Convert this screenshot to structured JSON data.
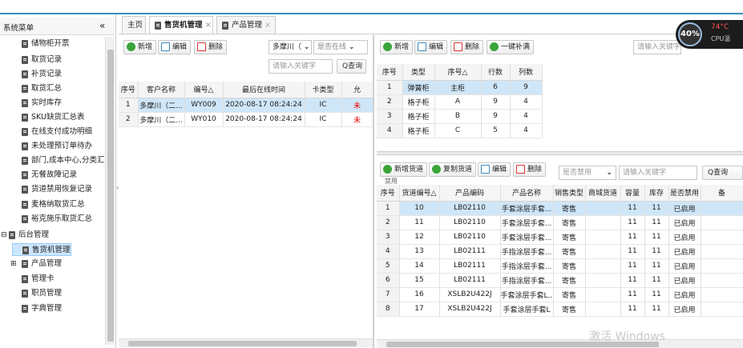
{
  "sidebar": {
    "title": "系统菜单",
    "collapse": "«",
    "items": [
      {
        "label": "储物柜开票",
        "icon": "file-icon"
      },
      {
        "label": "取货记录",
        "icon": "file-icon"
      },
      {
        "label": "补货记录",
        "icon": "file-icon"
      },
      {
        "label": "取货汇总",
        "icon": "file-icon"
      },
      {
        "label": "实时库存",
        "icon": "file-icon"
      },
      {
        "label": "SKU缺货汇总表",
        "icon": "file-icon"
      },
      {
        "label": "在线支付成功明细",
        "icon": "file-icon"
      },
      {
        "label": "未处理预订单待办",
        "icon": "file-icon"
      },
      {
        "label": "部门,成本中心,分类汇总",
        "icon": "file-icon"
      },
      {
        "label": "无餐故障记录",
        "icon": "file-icon"
      },
      {
        "label": "货道禁用恢复记录",
        "icon": "file-icon"
      },
      {
        "label": "麦格纳取货汇总",
        "icon": "file-icon"
      },
      {
        "label": "裕克施乐取货汇总",
        "icon": "file-icon"
      },
      {
        "label": "后台管理",
        "icon": "folder-icon"
      },
      {
        "label": "售货机管理",
        "icon": "file-icon"
      },
      {
        "label": "产品管理",
        "icon": "file-icon"
      },
      {
        "label": "管理卡",
        "icon": "file-icon"
      },
      {
        "label": "职员管理",
        "icon": "file-icon"
      },
      {
        "label": "字典管理",
        "icon": "file-icon"
      }
    ]
  },
  "tabs": [
    {
      "label": "主页"
    },
    {
      "label": "售货机管理",
      "close": "×"
    },
    {
      "label": "产品管理",
      "close": "×"
    }
  ],
  "left": {
    "toolbar": {
      "add": "新增",
      "edit": "编辑",
      "delete": "删除",
      "area": "多摩川（",
      "online": "是否在线",
      "search_ph": "请输入关键字",
      "search": "Q查询"
    },
    "columns": [
      "序号",
      "客户名称",
      "编号△",
      "最后在线时间",
      "卡类型",
      "允"
    ],
    "rows": [
      [
        "1",
        "多摩川（二...",
        "WY009",
        "2020-08-17 08:24:24",
        "IC",
        "未"
      ],
      [
        "2",
        "多摩川（二...",
        "WY010",
        "2020-08-17 08:24:24",
        "IC",
        "未"
      ]
    ]
  },
  "right_top": {
    "toolbar": {
      "add": "新增",
      "edit": "编辑",
      "delete": "删除",
      "fill": "一键补满",
      "search_ph": "请输入关键字"
    },
    "columns": [
      "序号",
      "类型",
      "序号△",
      "行数",
      "列数"
    ],
    "rows": [
      [
        "1",
        "弹簧柜",
        "主柜",
        "6",
        "9"
      ],
      [
        "2",
        "格子柜",
        "A",
        "9",
        "4"
      ],
      [
        "3",
        "格子柜",
        "B",
        "9",
        "4"
      ],
      [
        "4",
        "格子柜",
        "C",
        "5",
        "4"
      ]
    ]
  },
  "right_bottom": {
    "toolbar": {
      "add": "新增货道",
      "copy": "复制货道",
      "edit": "编辑",
      "delete": "删除",
      "disabled": "是否禁用",
      "search_ph": "请输入关键字",
      "search": "Q查询",
      "cut": "禁用"
    },
    "columns": [
      "序号",
      "货道编号△",
      "产品编码",
      "产品名称",
      "销售类型",
      "商城货道",
      "容量",
      "库存",
      "是否禁用",
      "备"
    ],
    "rows": [
      [
        "1",
        "10",
        "LB02110",
        "手套涂层手套...",
        "寄售",
        "",
        "11",
        "11",
        "已启用"
      ],
      [
        "2",
        "11",
        "LB02110",
        "手套涂层手套...",
        "寄售",
        "",
        "11",
        "11",
        "已启用"
      ],
      [
        "3",
        "12",
        "LB02110",
        "手套涂层手套...",
        "寄售",
        "",
        "11",
        "11",
        "已启用"
      ],
      [
        "4",
        "13",
        "LB02111",
        "手指涂层手套...",
        "寄售",
        "",
        "11",
        "11",
        "已启用"
      ],
      [
        "5",
        "14",
        "LB02111",
        "手指涂层手套...",
        "寄售",
        "",
        "11",
        "11",
        "已启用"
      ],
      [
        "6",
        "15",
        "LB02111",
        "手指涂层手套...",
        "寄售",
        "",
        "11",
        "11",
        "已启用"
      ],
      [
        "7",
        "16",
        "XSLB2U422J",
        "手套涂层手套L...",
        "寄售",
        "",
        "11",
        "11",
        "已启用"
      ],
      [
        "8",
        "17",
        "XSLB2U422J",
        "手套涂层手套L",
        "寄售",
        "",
        "11",
        "11",
        "已启用"
      ]
    ]
  },
  "cpu": {
    "percent": "40%",
    "temp": "74°C",
    "label": "CPU温"
  },
  "watermark": "激活 Windows",
  "colors": {
    "accent": "#3c8dbc",
    "highlight": "#cfe6f8",
    "red": "#e00000"
  }
}
